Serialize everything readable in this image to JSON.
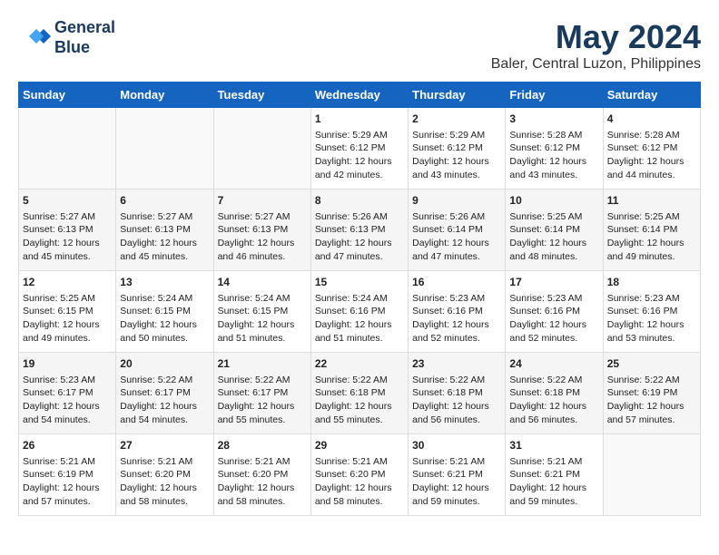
{
  "header": {
    "logo_line1": "General",
    "logo_line2": "Blue",
    "title": "May 2024",
    "subtitle": "Baler, Central Luzon, Philippines"
  },
  "calendar": {
    "days_of_week": [
      "Sunday",
      "Monday",
      "Tuesday",
      "Wednesday",
      "Thursday",
      "Friday",
      "Saturday"
    ],
    "weeks": [
      [
        {
          "day": "",
          "content": ""
        },
        {
          "day": "",
          "content": ""
        },
        {
          "day": "",
          "content": ""
        },
        {
          "day": "1",
          "content": "Sunrise: 5:29 AM\nSunset: 6:12 PM\nDaylight: 12 hours\nand 42 minutes."
        },
        {
          "day": "2",
          "content": "Sunrise: 5:29 AM\nSunset: 6:12 PM\nDaylight: 12 hours\nand 43 minutes."
        },
        {
          "day": "3",
          "content": "Sunrise: 5:28 AM\nSunset: 6:12 PM\nDaylight: 12 hours\nand 43 minutes."
        },
        {
          "day": "4",
          "content": "Sunrise: 5:28 AM\nSunset: 6:12 PM\nDaylight: 12 hours\nand 44 minutes."
        }
      ],
      [
        {
          "day": "5",
          "content": "Sunrise: 5:27 AM\nSunset: 6:13 PM\nDaylight: 12 hours\nand 45 minutes."
        },
        {
          "day": "6",
          "content": "Sunrise: 5:27 AM\nSunset: 6:13 PM\nDaylight: 12 hours\nand 45 minutes."
        },
        {
          "day": "7",
          "content": "Sunrise: 5:27 AM\nSunset: 6:13 PM\nDaylight: 12 hours\nand 46 minutes."
        },
        {
          "day": "8",
          "content": "Sunrise: 5:26 AM\nSunset: 6:13 PM\nDaylight: 12 hours\nand 47 minutes."
        },
        {
          "day": "9",
          "content": "Sunrise: 5:26 AM\nSunset: 6:14 PM\nDaylight: 12 hours\nand 47 minutes."
        },
        {
          "day": "10",
          "content": "Sunrise: 5:25 AM\nSunset: 6:14 PM\nDaylight: 12 hours\nand 48 minutes."
        },
        {
          "day": "11",
          "content": "Sunrise: 5:25 AM\nSunset: 6:14 PM\nDaylight: 12 hours\nand 49 minutes."
        }
      ],
      [
        {
          "day": "12",
          "content": "Sunrise: 5:25 AM\nSunset: 6:15 PM\nDaylight: 12 hours\nand 49 minutes."
        },
        {
          "day": "13",
          "content": "Sunrise: 5:24 AM\nSunset: 6:15 PM\nDaylight: 12 hours\nand 50 minutes."
        },
        {
          "day": "14",
          "content": "Sunrise: 5:24 AM\nSunset: 6:15 PM\nDaylight: 12 hours\nand 51 minutes."
        },
        {
          "day": "15",
          "content": "Sunrise: 5:24 AM\nSunset: 6:16 PM\nDaylight: 12 hours\nand 51 minutes."
        },
        {
          "day": "16",
          "content": "Sunrise: 5:23 AM\nSunset: 6:16 PM\nDaylight: 12 hours\nand 52 minutes."
        },
        {
          "day": "17",
          "content": "Sunrise: 5:23 AM\nSunset: 6:16 PM\nDaylight: 12 hours\nand 52 minutes."
        },
        {
          "day": "18",
          "content": "Sunrise: 5:23 AM\nSunset: 6:16 PM\nDaylight: 12 hours\nand 53 minutes."
        }
      ],
      [
        {
          "day": "19",
          "content": "Sunrise: 5:23 AM\nSunset: 6:17 PM\nDaylight: 12 hours\nand 54 minutes."
        },
        {
          "day": "20",
          "content": "Sunrise: 5:22 AM\nSunset: 6:17 PM\nDaylight: 12 hours\nand 54 minutes."
        },
        {
          "day": "21",
          "content": "Sunrise: 5:22 AM\nSunset: 6:17 PM\nDaylight: 12 hours\nand 55 minutes."
        },
        {
          "day": "22",
          "content": "Sunrise: 5:22 AM\nSunset: 6:18 PM\nDaylight: 12 hours\nand 55 minutes."
        },
        {
          "day": "23",
          "content": "Sunrise: 5:22 AM\nSunset: 6:18 PM\nDaylight: 12 hours\nand 56 minutes."
        },
        {
          "day": "24",
          "content": "Sunrise: 5:22 AM\nSunset: 6:18 PM\nDaylight: 12 hours\nand 56 minutes."
        },
        {
          "day": "25",
          "content": "Sunrise: 5:22 AM\nSunset: 6:19 PM\nDaylight: 12 hours\nand 57 minutes."
        }
      ],
      [
        {
          "day": "26",
          "content": "Sunrise: 5:21 AM\nSunset: 6:19 PM\nDaylight: 12 hours\nand 57 minutes."
        },
        {
          "day": "27",
          "content": "Sunrise: 5:21 AM\nSunset: 6:20 PM\nDaylight: 12 hours\nand 58 minutes."
        },
        {
          "day": "28",
          "content": "Sunrise: 5:21 AM\nSunset: 6:20 PM\nDaylight: 12 hours\nand 58 minutes."
        },
        {
          "day": "29",
          "content": "Sunrise: 5:21 AM\nSunset: 6:20 PM\nDaylight: 12 hours\nand 58 minutes."
        },
        {
          "day": "30",
          "content": "Sunrise: 5:21 AM\nSunset: 6:21 PM\nDaylight: 12 hours\nand 59 minutes."
        },
        {
          "day": "31",
          "content": "Sunrise: 5:21 AM\nSunset: 6:21 PM\nDaylight: 12 hours\nand 59 minutes."
        },
        {
          "day": "",
          "content": ""
        }
      ]
    ]
  }
}
